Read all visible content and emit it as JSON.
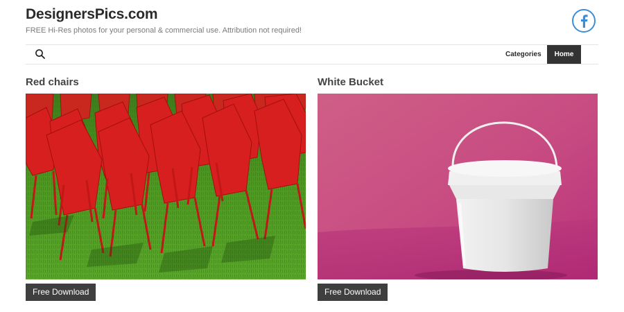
{
  "site": {
    "title": "DesignersPics.com",
    "tagline": "FREE Hi-Res photos for your personal & commercial use. Attribution not required!",
    "accent_color": "#3b8ed6",
    "social_icon": "facebook-icon"
  },
  "nav": {
    "search_icon": "search-icon",
    "items": [
      {
        "label": "Categories",
        "active": false
      },
      {
        "label": "Home",
        "active": true
      }
    ]
  },
  "posts": [
    {
      "title": "Red chairs",
      "image_subject": "red-chairs-photo",
      "button_label": "Free Download"
    },
    {
      "title": "White Bucket",
      "image_subject": "white-bucket-photo",
      "button_label": "Free Download"
    }
  ]
}
